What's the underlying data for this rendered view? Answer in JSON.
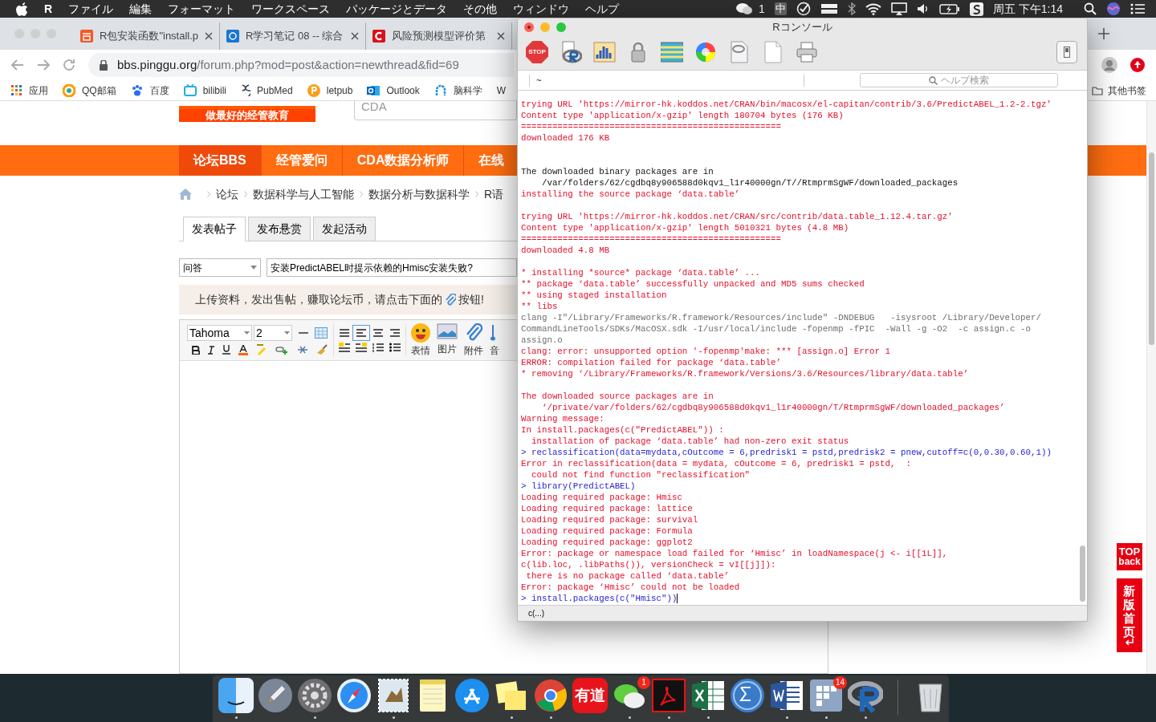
{
  "menu_bar": {
    "app": "R",
    "menus": [
      "ファイル",
      "編集",
      "フォーマット",
      "ワークスペース",
      "パッケージとデータ",
      "その他",
      "ウィンドウ",
      "ヘルプ"
    ],
    "status": {
      "chat_count": "1",
      "input_method": "中",
      "clock": "周五 下午1:14"
    }
  },
  "browser": {
    "tabs": [
      {
        "title": "R包安装函数\"install.p",
        "kind": "jian",
        "selected": false
      },
      {
        "title": "R学习笔记 08 -- 综合",
        "kind": "blue",
        "selected": false
      },
      {
        "title": "风险预测模型评价第",
        "kind": "c",
        "selected": false
      }
    ],
    "url": {
      "host": "bbs.pinggu.org",
      "path": "/forum.php?mod=post&action=newthread&fid=69"
    },
    "bookmarks": [
      {
        "label": "应用",
        "kind": "apps"
      },
      {
        "label": "QQ邮箱",
        "kind": "qq"
      },
      {
        "label": "百度",
        "kind": "paw"
      },
      {
        "label": "bilibili",
        "kind": "tv"
      },
      {
        "label": "PubMed",
        "kind": "helix"
      },
      {
        "label": "letpub",
        "kind": "p"
      },
      {
        "label": "Outlook",
        "kind": "outlook"
      },
      {
        "label": "脑科学",
        "kind": "brain"
      },
      {
        "label": "W",
        "kind": "plain"
      }
    ],
    "other_bookmarks": "其他书签"
  },
  "page": {
    "logo_slogan": "做最好的经管教育",
    "search_value": "CDA",
    "nav": [
      {
        "label": "论坛BBS",
        "selected": true
      },
      {
        "label": "经管爱问",
        "selected": false
      },
      {
        "label": "CDA数据分析师",
        "selected": false
      },
      {
        "label": "在线",
        "selected": false
      }
    ],
    "breadcrumb": [
      "论坛",
      "数据科学与人工智能",
      "数据分析与数据科学",
      "R语"
    ],
    "post_tabs": [
      {
        "label": "发表帖子",
        "selected": true
      },
      {
        "label": "发布悬赏",
        "selected": false
      },
      {
        "label": "发起活动",
        "selected": false
      }
    ],
    "category": "问答",
    "title_value": "安装PredictABEL时提示依赖的Hmisc安装失败?",
    "notice": {
      "before": "上传资料，发出售帖，赚取论坛币，请点击下面的",
      "after": "按钮!"
    },
    "editor": {
      "font": "Tahoma",
      "size": "2",
      "tools": [
        {
          "label": "表情",
          "kind": "smiley"
        },
        {
          "label": "图片",
          "kind": "image"
        },
        {
          "label": "附件",
          "kind": "clip"
        },
        {
          "label": "音",
          "kind": "note"
        }
      ]
    },
    "top_button": {
      "top": "TOP",
      "back": "back"
    },
    "new_home": "新版首页"
  },
  "r_console": {
    "title": "Rコンソール",
    "stop_label": "STOP",
    "directory": "~",
    "help_placeholder": "ヘルプ検索",
    "lines": [
      {
        "kind": "output",
        "text": "trying URL 'https://mirror-hk.koddos.net/CRAN/bin/macosx/el-capitan/contrib/3.6/PredictABEL_1.2-2.tgz'"
      },
      {
        "kind": "output",
        "text": "Content type 'application/x-gzip' length 180704 bytes (176 KB)"
      },
      {
        "kind": "output",
        "text": "=================================================="
      },
      {
        "kind": "output",
        "text": "downloaded 176 KB"
      },
      {
        "kind": "gap"
      },
      {
        "kind": "gap"
      },
      {
        "kind": "plain",
        "text": "The downloaded binary packages are in"
      },
      {
        "kind": "plain",
        "text": "    /var/folders/62/cgdbq8y906588d0kqv1_l1r40000gn/T//RtmprmSgWF/downloaded_packages"
      },
      {
        "kind": "output",
        "text": "installing the source package ‘data.table’"
      },
      {
        "kind": "gap"
      },
      {
        "kind": "output",
        "text": "trying URL 'https://mirror-hk.koddos.net/CRAN/src/contrib/data.table_1.12.4.tar.gz'"
      },
      {
        "kind": "output",
        "text": "Content type 'application/x-gzip' length 5010321 bytes (4.8 MB)"
      },
      {
        "kind": "output",
        "text": "=================================================="
      },
      {
        "kind": "output",
        "text": "downloaded 4.8 MB"
      },
      {
        "kind": "gap"
      },
      {
        "kind": "output",
        "text": "* installing *source* package ‘data.table’ ..."
      },
      {
        "kind": "output",
        "text": "** package ‘data.table’ successfully unpacked and MD5 sums checked"
      },
      {
        "kind": "output",
        "text": "** using staged installation"
      },
      {
        "kind": "output",
        "text": "** libs"
      },
      {
        "kind": "compile",
        "text": "clang -I\"/Library/Frameworks/R.framework/Resources/include\" -DNDEBUG   -isysroot /Library/Developer/"
      },
      {
        "kind": "compile",
        "text": "CommandLineTools/SDKs/MacOSX.sdk -I/usr/local/include -fopenmp -fPIC  -Wall -g -O2  -c assign.c -o"
      },
      {
        "kind": "compile",
        "text": "assign.o"
      },
      {
        "kind": "output",
        "text": "clang: error: unsupported option '-fopenmp'make: *** [assign.o] Error 1"
      },
      {
        "kind": "output",
        "text": "ERROR: compilation failed for package ‘data.table’"
      },
      {
        "kind": "output",
        "text": "* removing ‘/Library/Frameworks/R.framework/Versions/3.6/Resources/library/data.table’"
      },
      {
        "kind": "gap"
      },
      {
        "kind": "output",
        "text": "The downloaded source packages are in"
      },
      {
        "kind": "output",
        "text": "    ‘/private/var/folders/62/cgdbq8y906588d0kqv1_l1r40000gn/T/RtmprmSgWF/downloaded_packages’"
      },
      {
        "kind": "output",
        "text": "Warning message:"
      },
      {
        "kind": "output",
        "text": "In install.packages(c(\"PredictABEL\")) :"
      },
      {
        "kind": "output",
        "text": "  installation of package ‘data.table’ had non-zero exit status"
      },
      {
        "kind": "input",
        "text": "> reclassification(data=mydata,cOutcome = 6,predrisk1 = pstd,predrisk2 = pnew,cutoff=c(0,0.30,0.60,1))"
      },
      {
        "kind": "output",
        "text": "Error in reclassification(data = mydata, cOutcome = 6, predrisk1 = pstd,  :"
      },
      {
        "kind": "output",
        "text": "  could not find function \"reclassification\""
      },
      {
        "kind": "input",
        "text": "> library(PredictABEL)"
      },
      {
        "kind": "output",
        "text": "Loading required package: Hmisc"
      },
      {
        "kind": "output",
        "text": "Loading required package: lattice"
      },
      {
        "kind": "output",
        "text": "Loading required package: survival"
      },
      {
        "kind": "output",
        "text": "Loading required package: Formula"
      },
      {
        "kind": "output",
        "text": "Loading required package: ggplot2"
      },
      {
        "kind": "output",
        "text": "Error: package or namespace load failed for ‘Hmisc’ in loadNamespace(j <- i[[1L]],"
      },
      {
        "kind": "output",
        "text": "c(lib.loc, .libPaths()), versionCheck = vI[[j]]):"
      },
      {
        "kind": "output",
        "text": " there is no package called ‘data.table’"
      },
      {
        "kind": "output",
        "text": "Error: package ‘Hmisc’ could not be loaded"
      },
      {
        "kind": "input",
        "text": "> install.packages(c(\"Hmisc\"))",
        "cursor": true
      }
    ],
    "status": "c(...)"
  },
  "dock": {
    "apps": [
      {
        "kind": "finder",
        "running": true
      },
      {
        "kind": "rocket",
        "running": false
      },
      {
        "kind": "gear",
        "running": true
      },
      {
        "kind": "compass",
        "running": false
      },
      {
        "kind": "stamp",
        "running": true
      },
      {
        "kind": "notepad",
        "running": false
      },
      {
        "kind": "appstore",
        "running": false
      },
      {
        "kind": "stickies",
        "running": true
      },
      {
        "kind": "chrome",
        "running": true
      },
      {
        "kind": "youdao",
        "label": "有道",
        "running": false
      },
      {
        "kind": "chat",
        "badge": "1",
        "running": true
      },
      {
        "kind": "pdf",
        "running": true
      },
      {
        "kind": "sheet",
        "running": true
      },
      {
        "kind": "sigma",
        "running": false
      },
      {
        "kind": "doc",
        "running": true
      },
      {
        "kind": "grid",
        "badge": "14",
        "running": true
      },
      {
        "kind": "rlogo",
        "running": true
      },
      {
        "kind": "divider"
      },
      {
        "kind": "trash",
        "running": false
      }
    ]
  }
}
